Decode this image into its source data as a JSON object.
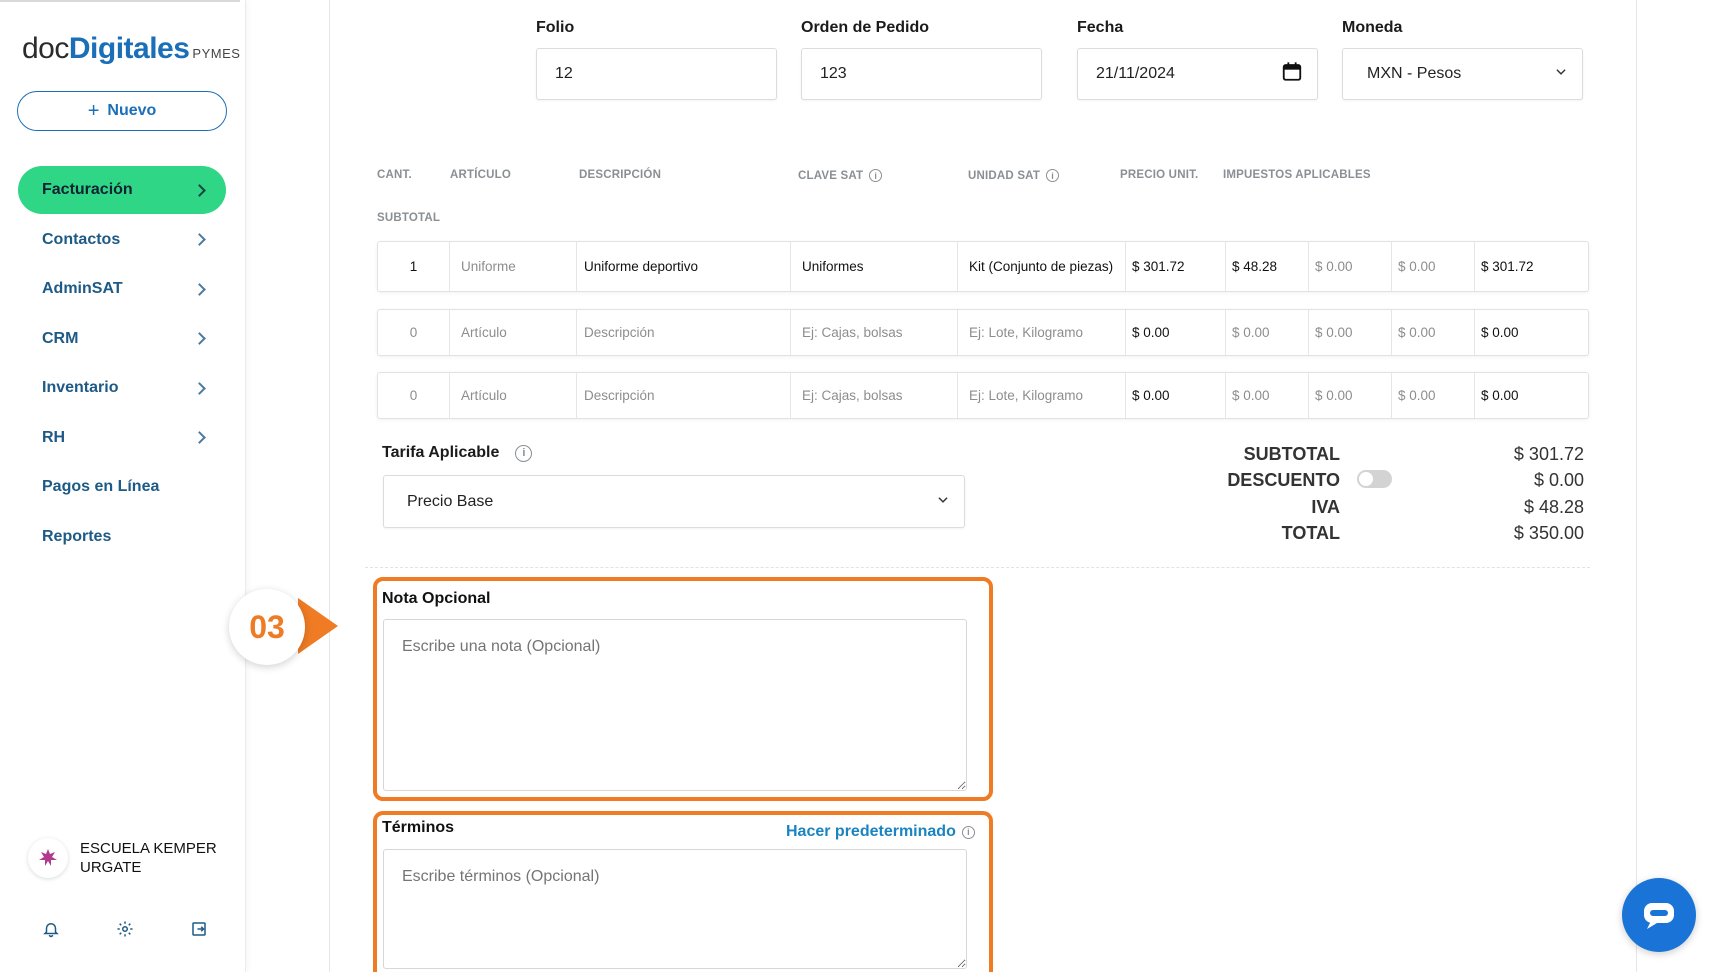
{
  "sidebar": {
    "logo": {
      "part1": "doc",
      "part2": "Digitales",
      "part3": "PYMES"
    },
    "new_button": "Nuevo",
    "items": [
      {
        "label": "Facturación",
        "has_chevron": true,
        "active": true
      },
      {
        "label": "Contactos",
        "has_chevron": true
      },
      {
        "label": "AdminSAT",
        "has_chevron": true
      },
      {
        "label": "CRM",
        "has_chevron": true
      },
      {
        "label": "Inventario",
        "has_chevron": true
      },
      {
        "label": "RH",
        "has_chevron": true
      },
      {
        "label": "Pagos en Línea",
        "has_chevron": false
      },
      {
        "label": "Reportes",
        "has_chevron": false
      }
    ],
    "org_name": "ESCUELA KEMPER URGATE",
    "icons": [
      "bell-icon",
      "gear-icon",
      "logout-icon"
    ]
  },
  "header_fields": {
    "folio": {
      "label": "Folio",
      "value": "12"
    },
    "orden": {
      "label": "Orden de Pedido",
      "value": "123"
    },
    "fecha": {
      "label": "Fecha",
      "value": "21/11/2024"
    },
    "moneda": {
      "label": "Moneda",
      "value": "MXN - Pesos"
    }
  },
  "table": {
    "headers": {
      "cant": "CANT.",
      "articulo": "ARTÍCULO",
      "descripcion": "DESCRIPCIÓN",
      "clave_sat": "CLAVE SAT",
      "unidad_sat": "UNIDAD SAT",
      "precio_unit": "PRECIO UNIT.",
      "impuestos": "IMPUESTOS APLICABLES",
      "subtotal": "SUBTOTAL"
    },
    "rows": [
      {
        "cant": "1",
        "articulo": "Uniforme",
        "descripcion": "Uniforme deportivo",
        "clave_sat": "Uniformes",
        "unidad_sat": "Kit (Conjunto de piezas)",
        "precio": "$ 301.72",
        "tax1": "$ 48.28",
        "tax2": "$ 0.00",
        "tax3": "$ 0.00",
        "subtotal": "$ 301.72"
      },
      {
        "cant": "0",
        "articulo": "Artículo",
        "descripcion": "Descripción",
        "clave_sat": "Ej: Cajas, bolsas",
        "unidad_sat": "Ej: Lote, Kilogramo",
        "precio": "$ 0.00",
        "tax1": "$ 0.00",
        "tax2": "$ 0.00",
        "tax3": "$ 0.00",
        "subtotal": "$ 0.00"
      },
      {
        "cant": "0",
        "articulo": "Artículo",
        "descripcion": "Descripción",
        "clave_sat": "Ej: Cajas, bolsas",
        "unidad_sat": "Ej: Lote, Kilogramo",
        "precio": "$ 0.00",
        "tax1": "$ 0.00",
        "tax2": "$ 0.00",
        "tax3": "$ 0.00",
        "subtotal": "$ 0.00"
      }
    ]
  },
  "tarifa": {
    "label": "Tarifa Aplicable",
    "value": "Precio Base"
  },
  "totals": {
    "subtotal_label": "SUBTOTAL",
    "subtotal": "$ 301.72",
    "descuento_label": "DESCUENTO",
    "descuento": "$ 0.00",
    "iva_label": "IVA",
    "iva": "$ 48.28",
    "total_label": "TOTAL",
    "total": "$ 350.00"
  },
  "nota": {
    "label": "Nota Opcional",
    "placeholder": "Escribe una nota (Opcional)"
  },
  "terminos": {
    "label": "Términos",
    "placeholder": "Escribe términos (Opcional)",
    "default_link": "Hacer predeterminado"
  },
  "step_badge": "03",
  "colors": {
    "accent_green": "#2ed685",
    "brand_blue": "#1a6fb8",
    "highlight_orange": "#ef7b24",
    "chat_blue": "#1a73d6"
  }
}
